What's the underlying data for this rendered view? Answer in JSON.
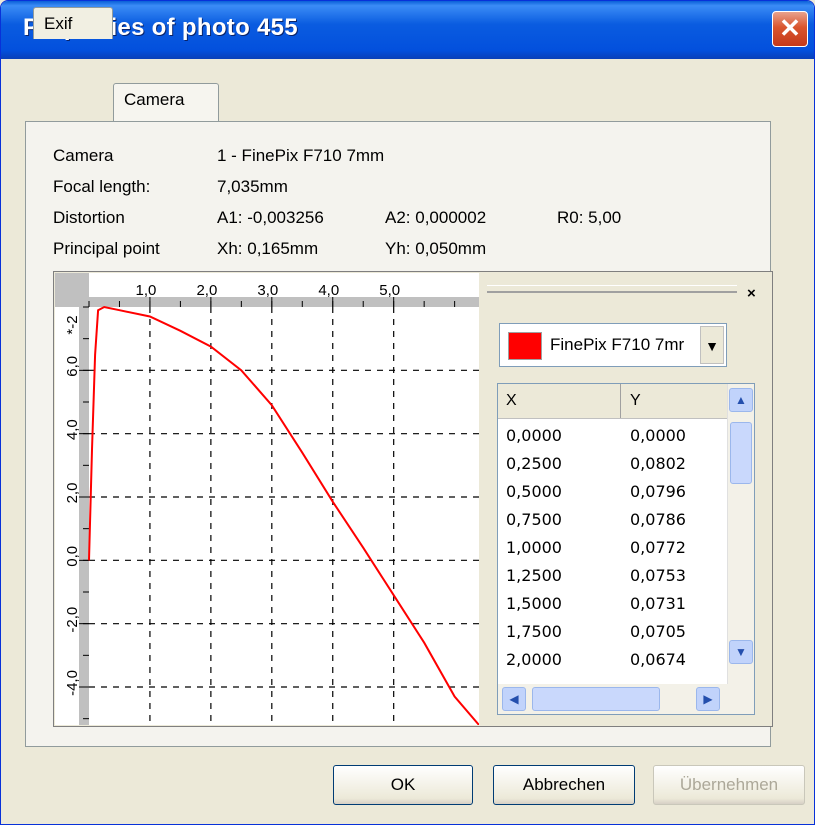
{
  "window": {
    "title": "Properties of photo 455"
  },
  "tabs": [
    {
      "label": "Exif"
    },
    {
      "label": "Camera"
    }
  ],
  "camera": {
    "camera_label": "Camera",
    "camera_value": "1 - FinePix F710 7mm",
    "focal_label": "Focal length:",
    "focal_value": "7,035mm",
    "distortion_label": "Distortion",
    "a1": "A1:  -0,003256",
    "a2": "A2:  0,000002",
    "r0": "R0:  5,00",
    "pp_label": "Principal point",
    "xh": "Xh:  0,165mm",
    "yh": "Yh:  0,050mm"
  },
  "chart_data": {
    "type": "line",
    "x_ticks": [
      "1,0",
      "2,0",
      "3,0",
      "4,0",
      "5,0"
    ],
    "y_ticks": [
      "6,0",
      "4,0",
      "2,0",
      "0,0",
      "-2,0",
      "-4,0"
    ],
    "y_unit": "*-2",
    "xlim": [
      0,
      6.4
    ],
    "ylim": [
      -5.2,
      8.0
    ],
    "grid": true,
    "series": [
      {
        "color": "#ff0000",
        "x": [
          0,
          0.05,
          0.1,
          0.15,
          0.25,
          0.5,
          1.0,
          1.5,
          2.0,
          2.5,
          3.0,
          3.5,
          4.0,
          4.5,
          5.0,
          5.5,
          6.0,
          6.4
        ],
        "y": [
          0,
          3.5,
          6.5,
          7.9,
          8.0,
          7.9,
          7.7,
          7.25,
          6.75,
          6.0,
          4.9,
          3.4,
          1.85,
          0.4,
          -1.1,
          -2.6,
          -4.3,
          -5.2
        ]
      }
    ]
  },
  "combo": {
    "color": "#ff0000",
    "value": "FinePix F710 7mr"
  },
  "table": {
    "headers": [
      "X",
      "Y"
    ],
    "rows": [
      [
        "0,0000",
        "0,0000"
      ],
      [
        "0,2500",
        "0,0802"
      ],
      [
        "0,5000",
        "0,0796"
      ],
      [
        "0,7500",
        "0,0786"
      ],
      [
        "1,0000",
        "0,0772"
      ],
      [
        "1,2500",
        "0,0753"
      ],
      [
        "1,5000",
        "0,0731"
      ],
      [
        "1,7500",
        "0,0705"
      ],
      [
        "2,0000",
        "0,0674"
      ]
    ]
  },
  "panel_close": "×",
  "buttons": {
    "ok": "OK",
    "cancel": "Abbrechen",
    "apply": "Übernehmen"
  }
}
